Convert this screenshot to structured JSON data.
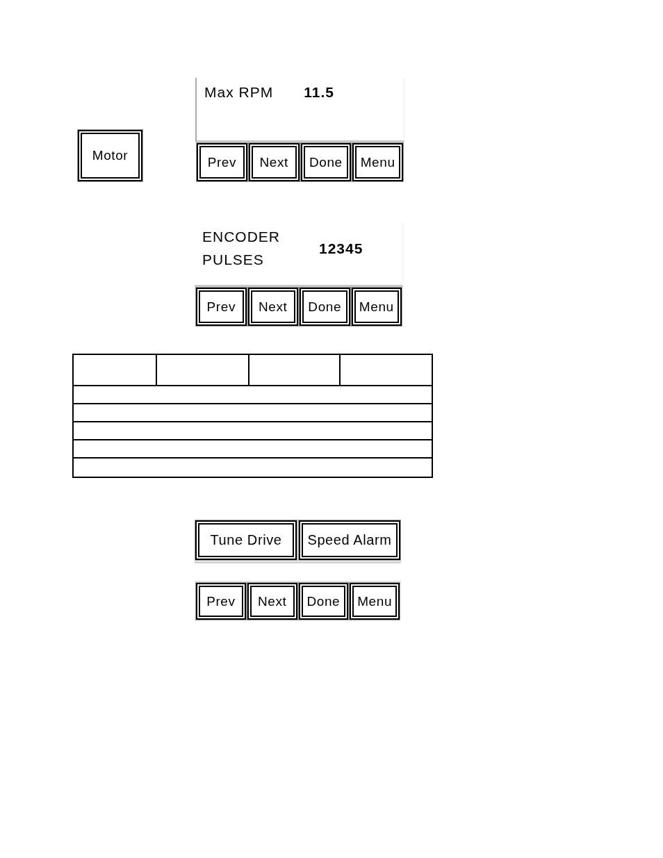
{
  "sections": [
    {
      "kind": "parameter_screen",
      "side_button": {
        "label": "Motor"
      },
      "label_lines": [
        "Max RPM"
      ],
      "value": "11.5",
      "nav_buttons": [
        "Prev",
        "Next",
        "Done",
        "Menu"
      ]
    },
    {
      "kind": "parameter_screen",
      "label_lines": [
        "ENCODER",
        "PULSES"
      ],
      "value": "12345",
      "nav_buttons": [
        "Prev",
        "Next",
        "Done",
        "Menu"
      ]
    },
    {
      "kind": "blank_table"
    },
    {
      "kind": "action_screen",
      "action_buttons": [
        "Tune Drive",
        "Speed Alarm"
      ],
      "nav_buttons": [
        "Prev",
        "Next",
        "Done",
        "Menu"
      ]
    }
  ]
}
